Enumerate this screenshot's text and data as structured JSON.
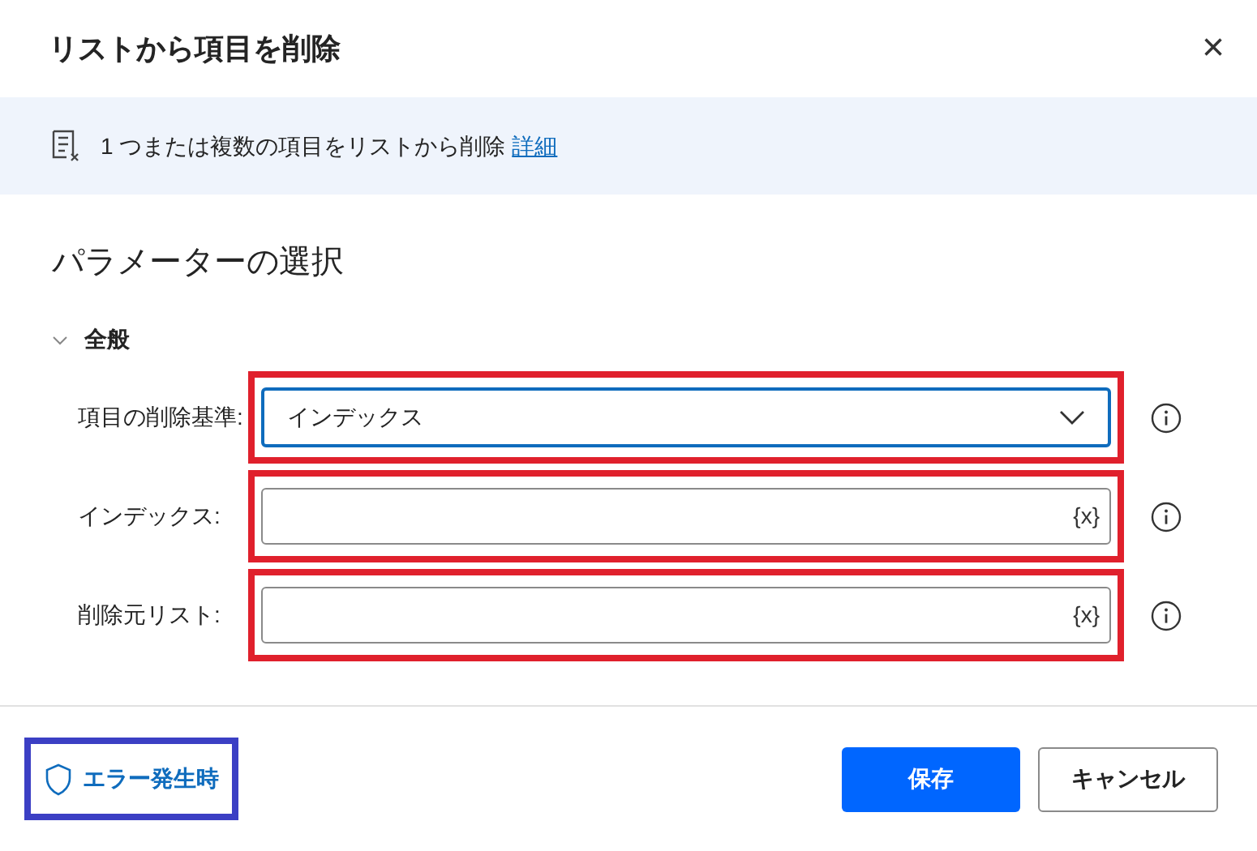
{
  "dialog": {
    "title": "リストから項目を削除",
    "close": "×"
  },
  "info": {
    "text": "1 つまたは複数の項目をリストから削除",
    "link": "詳細"
  },
  "section_title": "パラメーターの選択",
  "group": {
    "label": "全般",
    "expanded": true
  },
  "fields": [
    {
      "kind": "dropdown",
      "label": "項目の削除基準:",
      "value": "インデックス",
      "focused": true,
      "highlighted": true
    },
    {
      "kind": "text",
      "label": "インデックス:",
      "variable_button": "{x}",
      "focused": false,
      "highlighted": true
    },
    {
      "kind": "text",
      "label": "削除元リスト:",
      "variable_button": "{x}",
      "focused": false,
      "highlighted": true
    }
  ],
  "error_button": {
    "label": "エラー発生時",
    "highlighted": true
  },
  "buttons": [
    {
      "label": "保存",
      "kind": "primary"
    },
    {
      "label": "キャンセル",
      "kind": "secondary"
    }
  ]
}
